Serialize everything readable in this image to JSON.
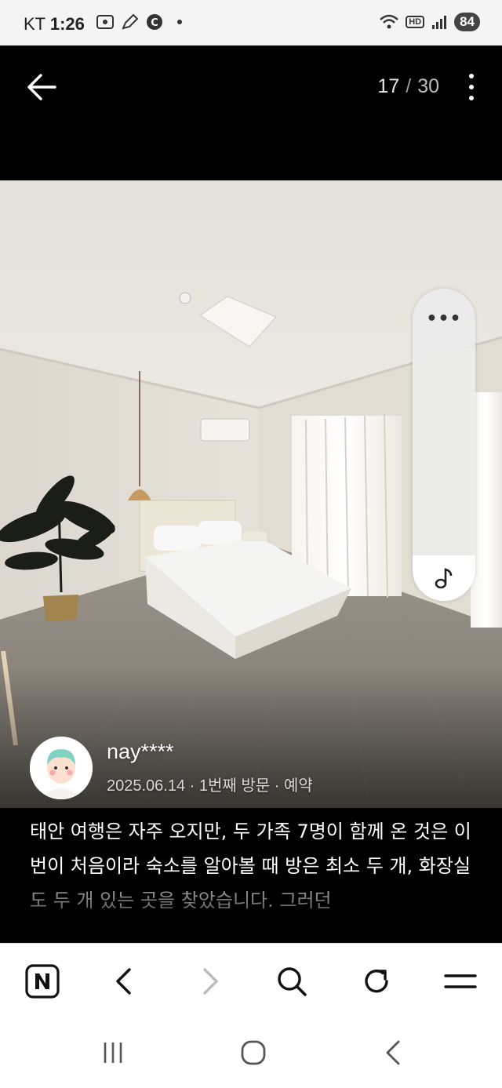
{
  "status_bar": {
    "carrier": "KT",
    "time": "1:26",
    "battery": "84",
    "hd_label": "HD",
    "icons": [
      "screenshot-icon",
      "pen-icon",
      "c-icon",
      "dot-icon",
      "wifi-icon",
      "hd-icon",
      "signal-icon",
      "battery-icon"
    ]
  },
  "header": {
    "current": "17",
    "separator": "/",
    "total": "30"
  },
  "photo": {
    "description_icon": "photo"
  },
  "widget": {
    "menu_dots": "•••"
  },
  "reviewer": {
    "name": "nay****",
    "meta": "2025.06.14 · 1번째 방문 · 예약"
  },
  "review": {
    "text": "태안 여행은 자주 오지만, 두 가족 7명이 함께 온 것은 이번이 처음이라 숙소를 알아볼 때 방은 최소 두 개, 화장실도 두 개 있는 곳을 찾았습니다. 그러던"
  },
  "toolbar": {
    "icons": [
      "naver-home-icon",
      "back-arrow-icon",
      "forward-arrow-icon",
      "search-icon",
      "refresh-icon",
      "menu-icon"
    ]
  },
  "colors": {
    "header_bg": "#000000",
    "toolbar_bg": "#ffffff",
    "text_primary": "#ffffff"
  }
}
